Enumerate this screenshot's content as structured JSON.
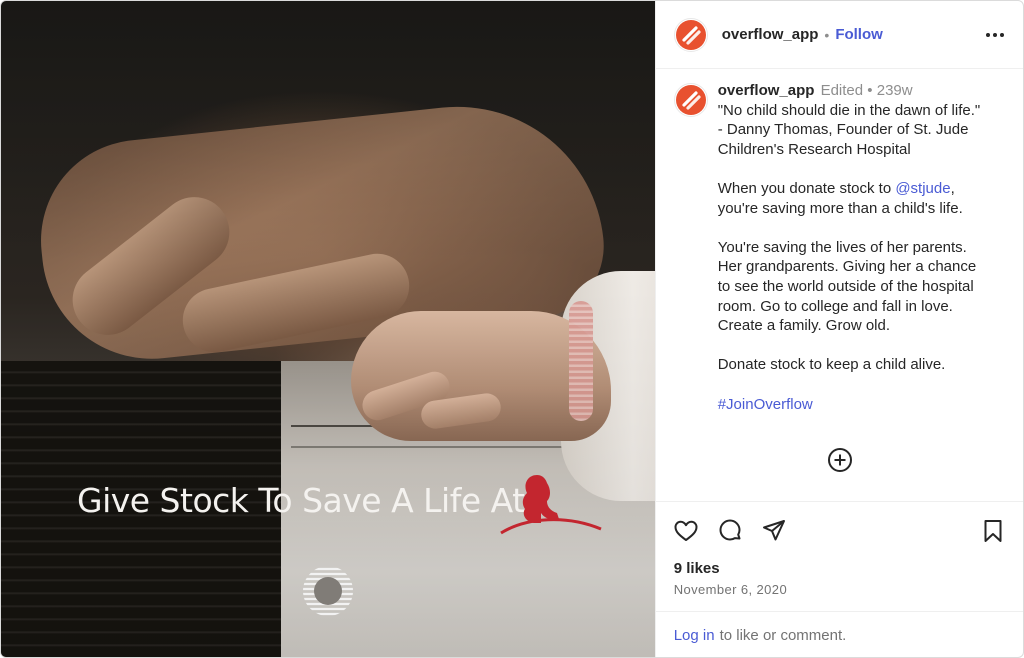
{
  "media": {
    "overlay_text": "Give Stock To Save A Life At"
  },
  "header": {
    "username": "overflow_app",
    "separator": "•",
    "follow_label": "Follow",
    "more_label": "•••"
  },
  "caption": {
    "username": "overflow_app",
    "edited_label": "Edited",
    "separator": "•",
    "age": "239w",
    "lines": {
      "quote_1": "\"No child should die in the dawn of life.\"",
      "quote_2": "- Danny Thomas, Founder of St. Jude",
      "quote_3": "Children's Research Hospital",
      "donate_prefix": "When you donate stock to ",
      "mention": "@stjude",
      "donate_suffix": ",",
      "donate_2": "you're saving more than a child's life.",
      "p3_1": "You're saving the lives of her parents.",
      "p3_2": "Her grandparents. Giving her a chance",
      "p3_3": "to see the world outside of the hospital",
      "p3_4": "room. Go to college and fall in love.",
      "p3_5": "Create a family. Grow old.",
      "p4": "Donate stock to keep a child alive.",
      "hashtag": "#JoinOverflow"
    }
  },
  "engagement": {
    "likes": "9 likes",
    "date": "November 6, 2020"
  },
  "footer": {
    "login_link": "Log in",
    "login_suffix": "to like or comment."
  },
  "colors": {
    "brand_accent": "#e8512f",
    "link_blue": "#4a5bd4",
    "stjude_red": "#c3262f"
  },
  "icons": [
    "overflow-logo-icon",
    "more-icon",
    "plus-circle-icon",
    "heart-icon",
    "comment-icon",
    "share-icon",
    "bookmark-icon",
    "st-jude-logo-icon",
    "overflow-mark-icon"
  ]
}
